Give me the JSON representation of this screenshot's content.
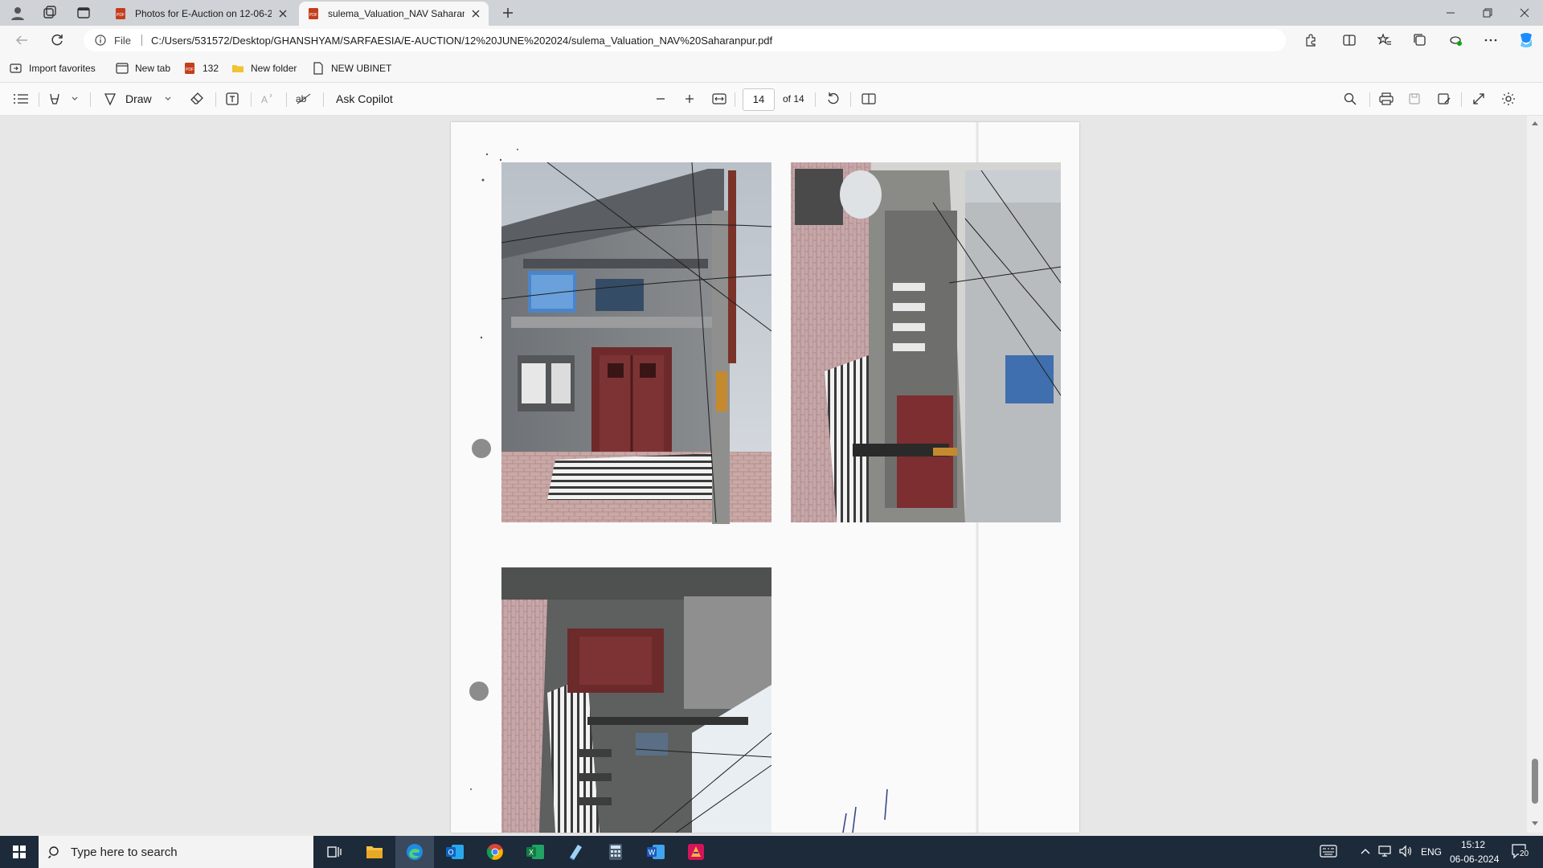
{
  "browser": {
    "tabs": [
      {
        "label": "Photos for E-Auction on 12-06-2",
        "active": false
      },
      {
        "label": "sulema_Valuation_NAV Saharanp",
        "active": true
      }
    ],
    "address": {
      "scheme_label": "File",
      "url": "C:/Users/531572/Desktop/GHANSHYAM/SARFAESIA/E-AUCTION/12%20JUNE%202024/sulema_Valuation_NAV%20Saharanpur.pdf"
    },
    "favorites": [
      {
        "label": "Import favorites",
        "icon": "import-icon"
      },
      {
        "label": "New tab",
        "icon": "newtab-icon"
      },
      {
        "label": "132",
        "icon": "pdf-icon"
      },
      {
        "label": "New folder",
        "icon": "folder-icon"
      },
      {
        "label": "NEW UBINET",
        "icon": "page-icon"
      }
    ]
  },
  "pdf_toolbar": {
    "draw_label": "Draw",
    "ask_copilot_label": "Ask Copilot",
    "page_number": "14",
    "page_total": "of 14"
  },
  "pdf_page": {
    "photos": [
      {
        "name": "photo-house-front",
        "description_icon": "photo"
      },
      {
        "name": "photo-street-rotated",
        "description_icon": "photo"
      },
      {
        "name": "photo-house-side-rotated",
        "description_icon": "photo"
      }
    ]
  },
  "taskbar": {
    "search_placeholder": "Type here to search",
    "apps": [
      "task-view",
      "file-explorer",
      "edge",
      "outlook",
      "chrome",
      "excel",
      "notepad",
      "calculator",
      "word",
      "media"
    ],
    "language": "ENG",
    "time": "15:12",
    "date": "06-06-2024",
    "notification_count": "20"
  },
  "colors": {
    "accent": "#0f6cbd",
    "taskbar": "#1c2a3a",
    "pdf_red": "#c43e1c"
  }
}
